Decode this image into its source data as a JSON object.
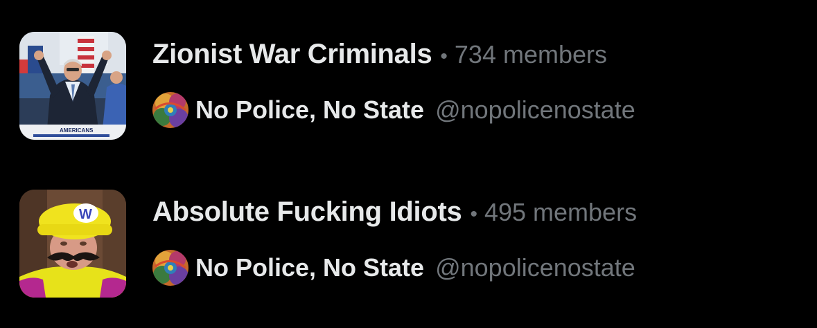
{
  "colors": {
    "background": "#000000",
    "primary_text": "#e7e9ea",
    "secondary_text": "#71767b"
  },
  "lists": [
    {
      "title": "Zionist War Criminals",
      "separator": "•",
      "member_count": "734 members",
      "thumbnail_icon": "rally-photo-thumbnail",
      "thumbnail_text": "AMERICANS",
      "owner": {
        "name": "No Police, No State",
        "handle": "@nopolicenostate",
        "avatar_icon": "colorful-abstract-avatar"
      }
    },
    {
      "title": "Absolute Fucking Idiots",
      "separator": "•",
      "member_count": "495 members",
      "thumbnail_icon": "wario-costume-photo-thumbnail",
      "thumbnail_text": "W",
      "owner": {
        "name": "No Police, No State",
        "handle": "@nopolicenostate",
        "avatar_icon": "colorful-abstract-avatar"
      }
    }
  ]
}
